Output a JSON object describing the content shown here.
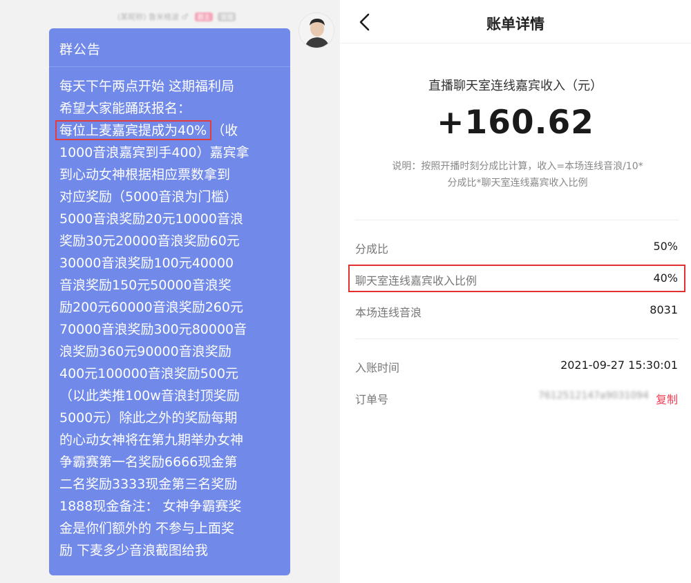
{
  "chat": {
    "sender_meta": "(某昵称) 鲁米格波 ♂",
    "sender_tag_1": "群主",
    "sender_tag_2": "管理",
    "bubble_title": "群公告",
    "lines": [
      "每天下午两点开始 这期福利局",
      "希望大家能踊跃报名：",
      "（收",
      "1000音浪嘉宾到手400）嘉宾拿",
      "到心动女神根据相应票数拿到",
      "对应奖励（5000音浪为门槛）",
      "5000音浪奖励20元10000音浪",
      "奖励30元20000音浪奖励60元",
      "30000音浪奖励100元40000",
      "音浪奖励150元50000音浪奖",
      "励200元60000音浪奖励260元",
      "70000音浪奖励300元80000音",
      "浪奖励360元90000音浪奖励",
      "400元100000音浪奖励500元",
      "（以此类推100w音浪封顶奖励",
      "5000元）除此之外的奖励每期",
      "的心动女神将在第九期举办女神",
      "争霸赛第一名奖励6666现金第",
      "二名奖励3333现金第三名奖励",
      "1888现金备注： 女神争霸赛奖",
      "金是你们额外的 不参与上面奖",
      "励 下麦多少音浪截图给我"
    ],
    "highlight_text": "每位上麦嘉宾提成为40%"
  },
  "bill": {
    "title": "账单详情",
    "income_label": "直播聊天室连线嘉宾收入（元）",
    "income_amount": "+160.62",
    "description_line1": "说明：按照开播时刻分成比计算，收入=本场连线音浪/10*",
    "description_line2": "分成比*聊天室连线嘉宾收入比例",
    "rows": [
      {
        "label": "分成比",
        "value": "50%"
      },
      {
        "label": "聊天室连线嘉宾收入比例",
        "value": "40%"
      },
      {
        "label": "本场连线音浪",
        "value": "8031"
      },
      {
        "label": "入账时间",
        "value": "2021-09-27 15:30:01"
      },
      {
        "label": "订单号",
        "value": "7612512147a9031094"
      }
    ],
    "copy_label": "复制"
  },
  "colors": {
    "bubble": "#7189e9",
    "highlight_border": "#e03030",
    "copy_link": "#ee3f55"
  },
  "icons": {
    "back": "chevron-left-icon",
    "avatar": "user-avatar"
  }
}
